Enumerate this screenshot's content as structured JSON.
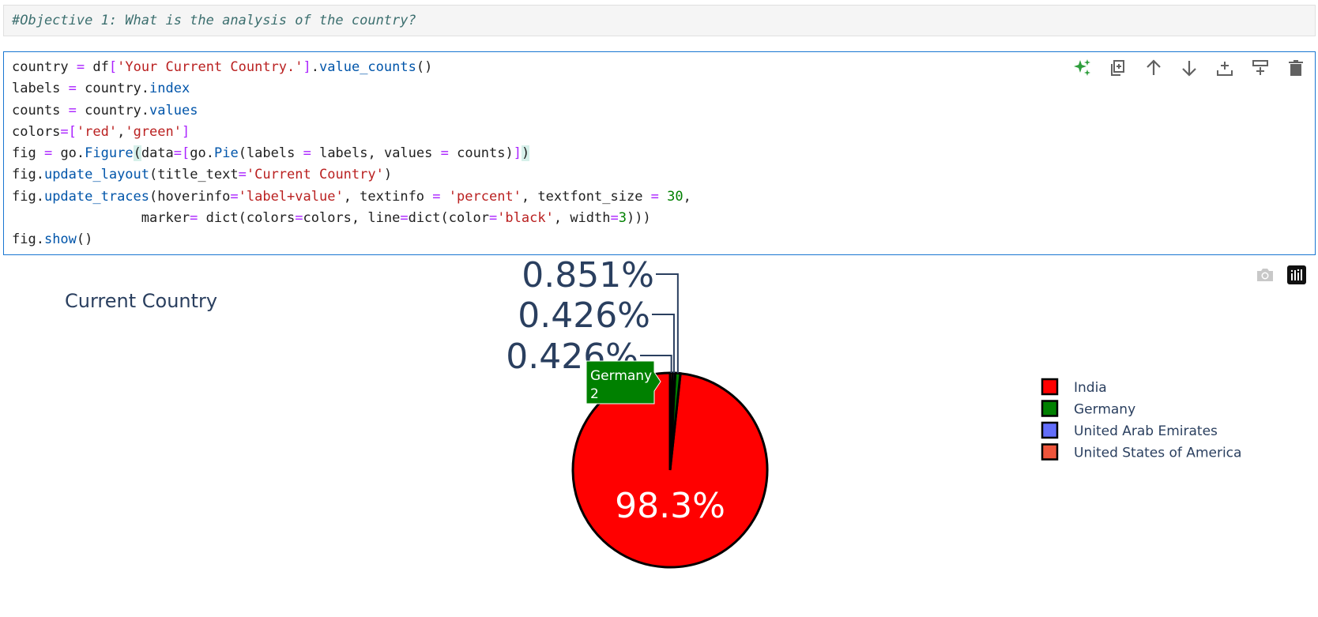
{
  "markdown_cell": {
    "text": "#Objective 1: What is the analysis of the country?"
  },
  "code_cell": {
    "toolbar": [
      {
        "icon": "sparkle-icon",
        "color": "#2e9e3c"
      },
      {
        "icon": "duplicate-icon"
      },
      {
        "icon": "arrow-up-icon"
      },
      {
        "icon": "arrow-down-icon"
      },
      {
        "icon": "insert-below-icon"
      },
      {
        "icon": "insert-above-icon"
      },
      {
        "icon": "trash-icon"
      }
    ],
    "lines": [
      [
        [
          "",
          "country "
        ],
        [
          "c-op",
          "="
        ],
        [
          "",
          " df"
        ],
        [
          "c-op",
          "["
        ],
        [
          "c-str",
          "'Your Current Country.'"
        ],
        [
          "c-op",
          "]"
        ],
        [
          "",
          "."
        ],
        [
          "c-fn",
          "value_counts"
        ],
        [
          "",
          "()"
        ]
      ],
      [
        [
          "",
          "labels "
        ],
        [
          "c-op",
          "="
        ],
        [
          "",
          " country."
        ],
        [
          "c-fn",
          "index"
        ]
      ],
      [
        [
          "",
          "counts "
        ],
        [
          "c-op",
          "="
        ],
        [
          "",
          " country."
        ],
        [
          "c-fn",
          "values"
        ]
      ],
      [
        [
          "",
          "colors"
        ],
        [
          "c-op",
          "=["
        ],
        [
          "c-str",
          "'red'"
        ],
        [
          "",
          ","
        ],
        [
          "c-str",
          "'green'"
        ],
        [
          "c-op",
          "]"
        ]
      ],
      [
        [
          "",
          "fig "
        ],
        [
          "c-op",
          "="
        ],
        [
          "",
          " go."
        ],
        [
          "c-fn",
          "Figure"
        ],
        [
          "c-br",
          "("
        ],
        [
          "",
          "data"
        ],
        [
          "c-op",
          "=["
        ],
        [
          "",
          "go."
        ],
        [
          "c-fn",
          "Pie"
        ],
        [
          "",
          "(labels "
        ],
        [
          "c-op",
          "="
        ],
        [
          "",
          " labels, values "
        ],
        [
          "c-op",
          "="
        ],
        [
          "",
          " counts)"
        ],
        [
          "c-op",
          "]"
        ],
        [
          "c-br",
          ")"
        ]
      ],
      [
        [
          "",
          "fig."
        ],
        [
          "c-fn",
          "update_layout"
        ],
        [
          "",
          "(title_text"
        ],
        [
          "c-op",
          "="
        ],
        [
          "c-str",
          "'Current Country'"
        ],
        [
          "",
          ")"
        ]
      ],
      [
        [
          "",
          "fig."
        ],
        [
          "c-fn",
          "update_traces"
        ],
        [
          "",
          "(hoverinfo"
        ],
        [
          "c-op",
          "="
        ],
        [
          "c-str",
          "'label+value'"
        ],
        [
          "",
          ", textinfo "
        ],
        [
          "c-op",
          "="
        ],
        [
          "",
          " "
        ],
        [
          "c-str",
          "'percent'"
        ],
        [
          "",
          ", textfont_size "
        ],
        [
          "c-op",
          "="
        ],
        [
          "",
          " "
        ],
        [
          "c-num",
          "30"
        ],
        [
          "",
          ","
        ]
      ],
      [
        [
          "",
          "                marker"
        ],
        [
          "c-op",
          "="
        ],
        [
          "",
          " dict(colors"
        ],
        [
          "c-op",
          "="
        ],
        [
          "",
          "colors, line"
        ],
        [
          "c-op",
          "="
        ],
        [
          "",
          "dict(color"
        ],
        [
          "c-op",
          "="
        ],
        [
          "c-str",
          "'black'"
        ],
        [
          "",
          ", width"
        ],
        [
          "c-op",
          "="
        ],
        [
          "c-num",
          "3"
        ],
        [
          "",
          ")))"
        ]
      ],
      [
        [
          "",
          "fig."
        ],
        [
          "c-fn",
          "show"
        ],
        [
          "",
          "()"
        ]
      ]
    ]
  },
  "output": {
    "modebar": [
      {
        "icon": "camera-icon"
      },
      {
        "icon": "plotly-logo-icon"
      }
    ],
    "tooltip": {
      "label": "Germany",
      "value": "2",
      "color": "#008000"
    }
  },
  "chart_data": {
    "type": "pie",
    "title": "Current Country",
    "slices": [
      {
        "label": "India",
        "percent": 98.3,
        "text": "98.3%",
        "color": "#ff0000"
      },
      {
        "label": "Germany",
        "percent": 0.851,
        "text": "0.851%",
        "color": "#008000"
      },
      {
        "label": "United Arab Emirates",
        "percent": 0.426,
        "text": "0.426%",
        "color": "#636efa"
      },
      {
        "label": "United States of America",
        "percent": 0.426,
        "text": "0.426%",
        "color": "#ef553b"
      }
    ],
    "legend": [
      "India",
      "Germany",
      "United Arab Emirates",
      "United States of America"
    ],
    "legend_position": "right",
    "slice_outline_color": "#000000"
  }
}
